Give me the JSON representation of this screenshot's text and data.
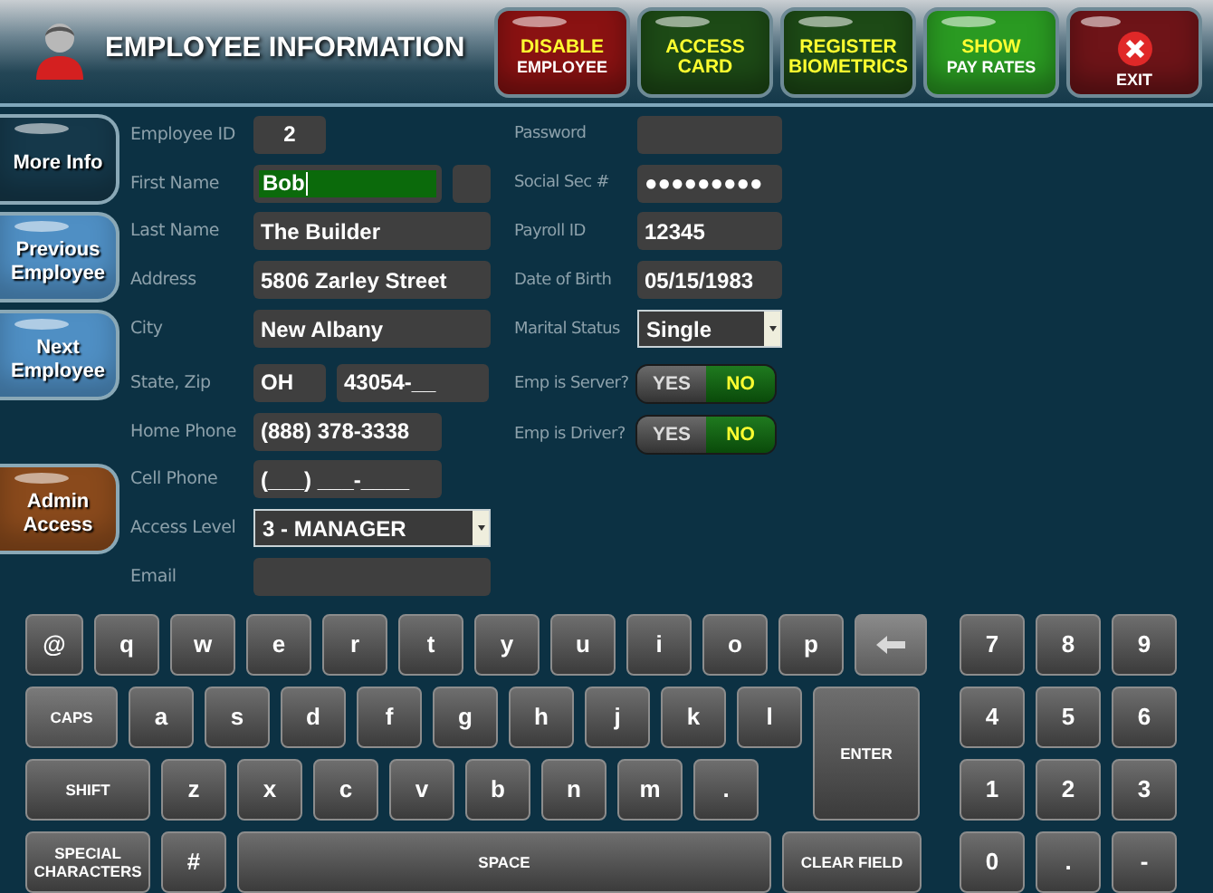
{
  "header": {
    "title": "EMPLOYEE INFORMATION",
    "actions": [
      {
        "kind": "text",
        "color": "#8a1212",
        "lines": [
          {
            "text": "DISABLE",
            "accent": true
          },
          {
            "text": "EMPLOYEE",
            "accent": false
          }
        ]
      },
      {
        "kind": "text",
        "color": "#1d4a16",
        "lines": [
          {
            "text": "ACCESS",
            "accent": true
          },
          {
            "text": "CARD",
            "accent": true
          }
        ]
      },
      {
        "kind": "text",
        "color": "#1d4a16",
        "lines": [
          {
            "text": "REGISTER",
            "accent": true
          },
          {
            "text": "BIOMETRICS",
            "accent": true
          }
        ]
      },
      {
        "kind": "text",
        "color": "#2a9a22",
        "lines": [
          {
            "text": "SHOW",
            "accent": true
          },
          {
            "text": "PAY RATES",
            "accent": false
          }
        ]
      },
      {
        "kind": "exit",
        "color": "#6e1418",
        "lines": [
          {
            "text": "EXIT",
            "accent": false
          }
        ]
      }
    ]
  },
  "nav": {
    "top": [
      {
        "label": "More Info",
        "color": "#15384a"
      },
      {
        "label": "Previous Employee",
        "color": "#4f8fc4"
      },
      {
        "label": "Next Employee",
        "color": "#4f8fc4"
      }
    ],
    "bottom": [
      {
        "label": "Admin Access",
        "color": "#8a4a1c"
      }
    ]
  },
  "form_left": [
    {
      "label": "Employee ID",
      "fields": [
        {
          "kind": "text",
          "value": "2"
        }
      ]
    },
    {
      "label": "First Name",
      "fields": [
        {
          "kind": "focused",
          "value": "Bob"
        },
        {
          "kind": "text"
        }
      ]
    },
    {
      "label": "Last Name",
      "fields": [
        {
          "kind": "text",
          "value": "The Builder"
        }
      ]
    },
    {
      "label": "Address",
      "fields": [
        {
          "kind": "text",
          "value": "5806 Zarley Street"
        }
      ]
    },
    {
      "label": "City",
      "fields": [
        {
          "kind": "text",
          "value": "New Albany"
        }
      ]
    },
    {
      "label": "State, Zip",
      "fields": [
        {
          "kind": "text",
          "value": "OH"
        },
        {
          "kind": "text",
          "value": "43054-__"
        }
      ]
    },
    {
      "label": "Home Phone",
      "fields": [
        {
          "kind": "text",
          "value": "(888) 378-3338"
        }
      ]
    },
    {
      "label": "Cell Phone",
      "fields": [
        {
          "kind": "text",
          "value": "(___) ___-____"
        }
      ]
    },
    {
      "label": "Access Level",
      "fields": [
        {
          "kind": "select",
          "value": "3 - MANAGER"
        }
      ]
    },
    {
      "label": "Email",
      "fields": [
        {
          "kind": "text"
        }
      ]
    }
  ],
  "form_right": [
    {
      "label": "Password",
      "kind": "field",
      "fields": [
        {
          "kind": "text"
        }
      ]
    },
    {
      "label": "Social Sec #",
      "kind": "field",
      "fields": [
        {
          "kind": "text",
          "value": "●●●●●●●●●"
        }
      ]
    },
    {
      "label": "Payroll ID",
      "kind": "field",
      "fields": [
        {
          "kind": "text",
          "value": "12345"
        }
      ]
    },
    {
      "label": "Date of Birth",
      "kind": "field",
      "fields": [
        {
          "kind": "text",
          "value": "05/15/1983"
        }
      ]
    },
    {
      "label": "Marital Status",
      "kind": "field",
      "fields": [
        {
          "kind": "select",
          "value": "Single"
        }
      ]
    },
    {
      "label": "Emp is Server?",
      "kind": "toggle",
      "options": [
        {
          "text": "YES",
          "selected": false
        },
        {
          "text": "NO",
          "selected": true
        }
      ]
    },
    {
      "label": "Emp is Driver?",
      "kind": "toggle",
      "options": [
        {
          "text": "YES",
          "selected": false
        },
        {
          "text": "NO",
          "selected": true
        }
      ]
    }
  ],
  "keyboard": {
    "rows": [
      {
        "keys": [
          {
            "label": "@",
            "kind": "narrow"
          },
          {
            "label": "q",
            "kind": "char"
          },
          {
            "label": "w",
            "kind": "char"
          },
          {
            "label": "e",
            "kind": "char"
          },
          {
            "label": "r",
            "kind": "char"
          },
          {
            "label": "t",
            "kind": "char"
          },
          {
            "label": "y",
            "kind": "char"
          },
          {
            "label": "u",
            "kind": "char"
          },
          {
            "label": "i",
            "kind": "char"
          },
          {
            "label": "o",
            "kind": "char"
          },
          {
            "label": "p",
            "kind": "char"
          },
          {
            "kind": "backspace"
          }
        ]
      },
      {
        "keys": [
          {
            "label": "CAPS",
            "kind": "caps"
          },
          {
            "label": "a",
            "kind": "char"
          },
          {
            "label": "s",
            "kind": "char"
          },
          {
            "label": "d",
            "kind": "char"
          },
          {
            "label": "f",
            "kind": "char"
          },
          {
            "label": "g",
            "kind": "char"
          },
          {
            "label": "h",
            "kind": "char"
          },
          {
            "label": "j",
            "kind": "char"
          },
          {
            "label": "k",
            "kind": "char"
          },
          {
            "label": "l",
            "kind": "char"
          }
        ]
      },
      {
        "keys": [
          {
            "label": "SHIFT",
            "kind": "wide"
          },
          {
            "label": "z",
            "kind": "char"
          },
          {
            "label": "x",
            "kind": "char"
          },
          {
            "label": "c",
            "kind": "char"
          },
          {
            "label": "v",
            "kind": "char"
          },
          {
            "label": "b",
            "kind": "char"
          },
          {
            "label": "n",
            "kind": "char"
          },
          {
            "label": "m",
            "kind": "char"
          },
          {
            "label": ".",
            "kind": "char"
          }
        ]
      },
      {
        "keys": [
          {
            "label": "SPECIAL CHARACTERS",
            "kind": "wide"
          },
          {
            "label": "#",
            "kind": "char"
          },
          {
            "label": "SPACE",
            "kind": "space"
          },
          {
            "label": "CLEAR FIELD",
            "kind": "clear"
          }
        ]
      }
    ],
    "enter": {
      "label": "ENTER"
    },
    "numpad": [
      [
        {
          "label": "7"
        },
        {
          "label": "8"
        },
        {
          "label": "9"
        }
      ],
      [
        {
          "label": "4"
        },
        {
          "label": "5"
        },
        {
          "label": "6"
        }
      ],
      [
        {
          "label": "1"
        },
        {
          "label": "2"
        },
        {
          "label": "3"
        }
      ],
      [
        {
          "label": "0"
        },
        {
          "label": "."
        },
        {
          "label": "-"
        }
      ]
    ]
  }
}
